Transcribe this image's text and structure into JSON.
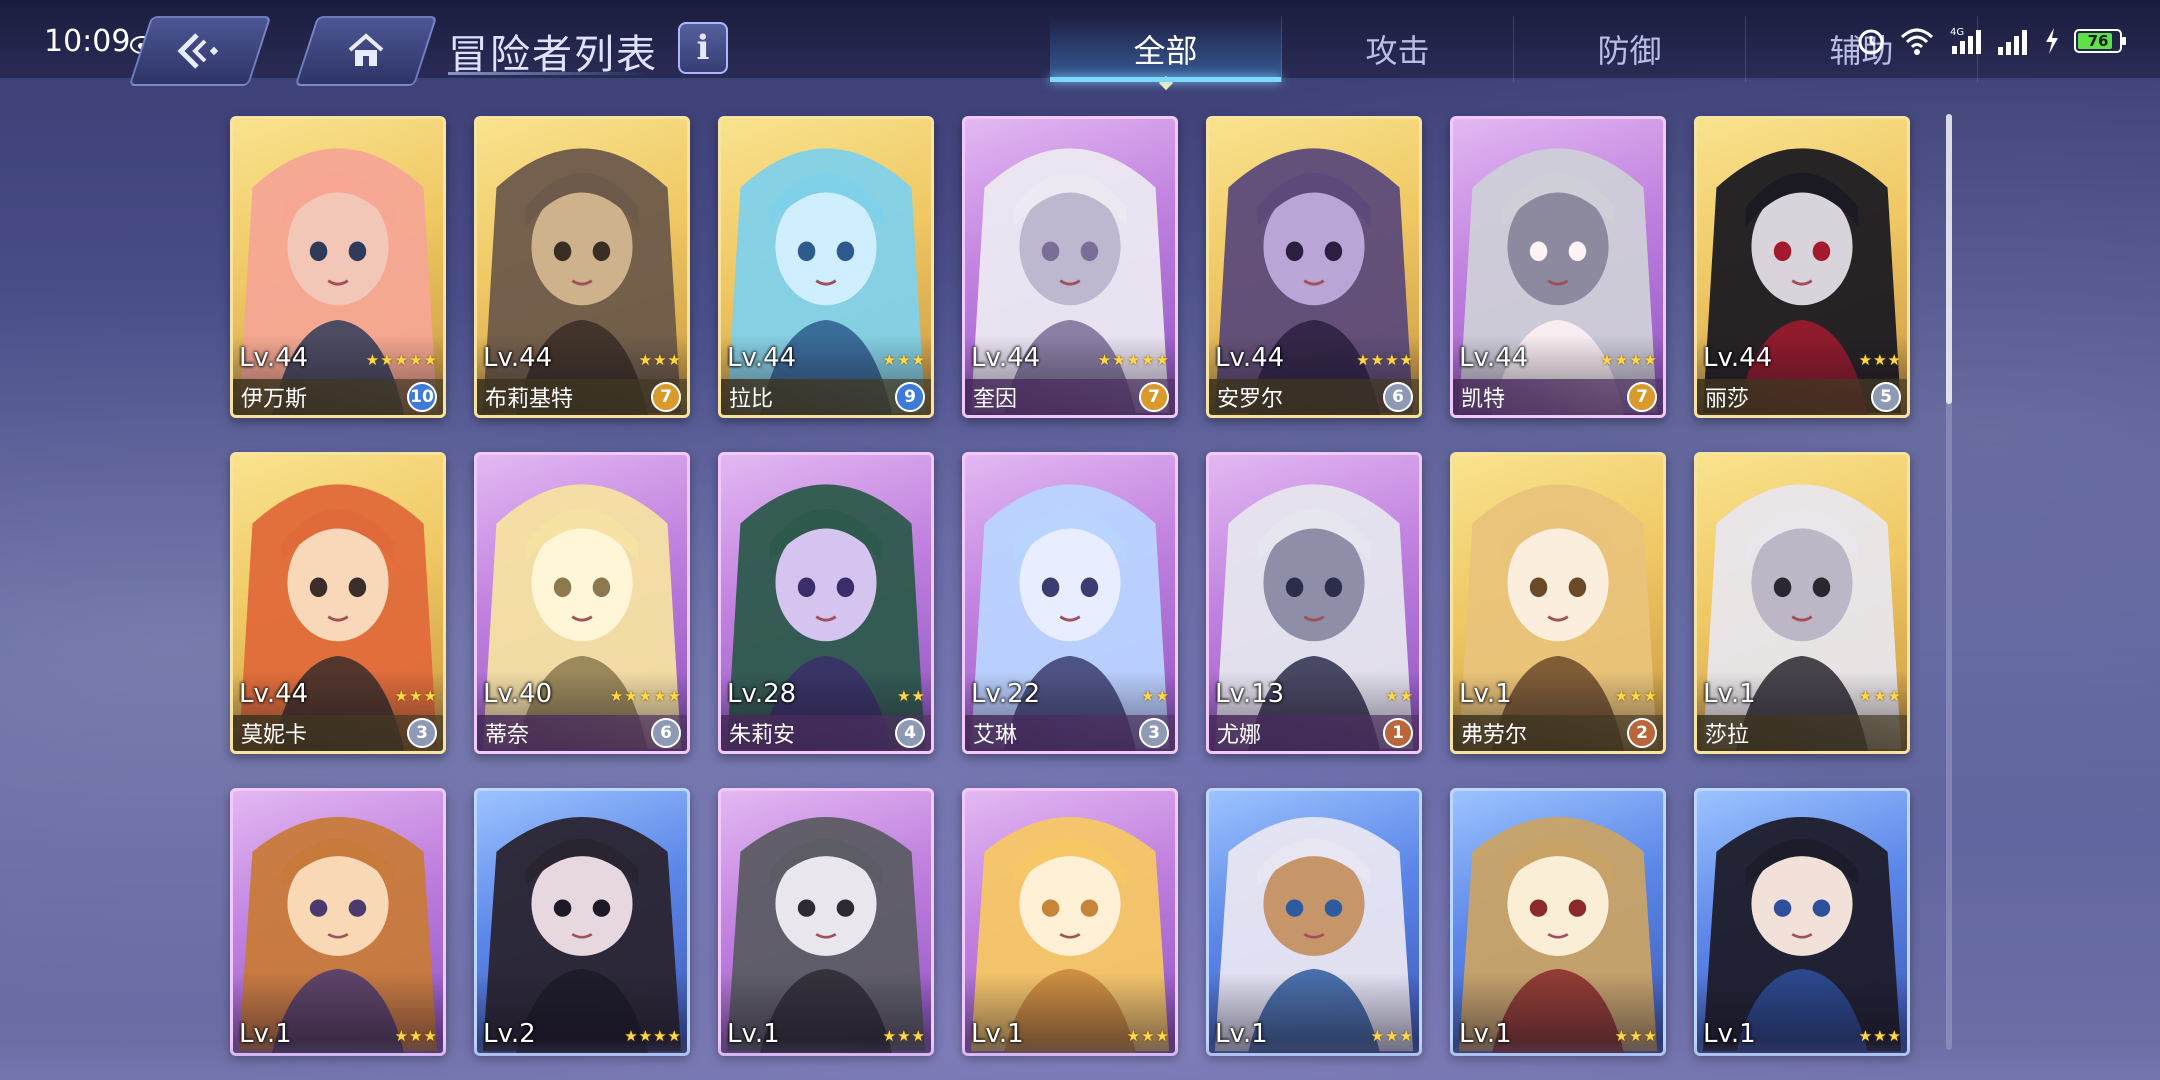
{
  "status_bar": {
    "time": "10:09",
    "battery": "76",
    "network": "4G"
  },
  "header": {
    "title": "冒险者列表",
    "info_label": "i",
    "tabs": [
      {
        "label": "全部",
        "active": true
      },
      {
        "label": "攻击",
        "active": false
      },
      {
        "label": "防御",
        "active": false
      },
      {
        "label": "辅助",
        "active": false
      }
    ]
  },
  "colors": {
    "accent": "#7fd6ff",
    "gold_frame": "#f0c864",
    "purple_frame": "#bf7fde",
    "blue_frame": "#5b86e8"
  },
  "adventurers": [
    {
      "name": "伊万斯",
      "level": "Lv.44",
      "stars": 5,
      "rank": "10",
      "frame": "gold",
      "badge": "blue"
    },
    {
      "name": "布莉基特",
      "level": "Lv.44",
      "stars": 3,
      "rank": "7",
      "frame": "gold",
      "badge": "gold"
    },
    {
      "name": "拉比",
      "level": "Lv.44",
      "stars": 3,
      "rank": "9",
      "frame": "gold",
      "badge": "blue"
    },
    {
      "name": "奎因",
      "level": "Lv.44",
      "stars": 5,
      "rank": "7",
      "frame": "purple",
      "badge": "gold"
    },
    {
      "name": "安罗尔",
      "level": "Lv.44",
      "stars": 4,
      "rank": "6",
      "frame": "gold",
      "badge": "silver"
    },
    {
      "name": "凯特",
      "level": "Lv.44",
      "stars": 4,
      "rank": "7",
      "frame": "purple",
      "badge": "gold"
    },
    {
      "name": "丽莎",
      "level": "Lv.44",
      "stars": 3,
      "rank": "5",
      "frame": "gold",
      "badge": "silver"
    },
    {
      "name": "莫妮卡",
      "level": "Lv.44",
      "stars": 3,
      "rank": "3",
      "frame": "gold",
      "badge": "silver"
    },
    {
      "name": "蒂奈",
      "level": "Lv.40",
      "stars": 5,
      "rank": "6",
      "frame": "purple",
      "badge": "silver"
    },
    {
      "name": "朱莉安",
      "level": "Lv.28",
      "stars": 2,
      "rank": "4",
      "frame": "purple",
      "badge": "silver"
    },
    {
      "name": "艾琳",
      "level": "Lv.22",
      "stars": 2,
      "rank": "3",
      "frame": "purple",
      "badge": "silver"
    },
    {
      "name": "尤娜",
      "level": "Lv.13",
      "stars": 2,
      "rank": "1",
      "frame": "purple",
      "badge": "bronze"
    },
    {
      "name": "弗劳尔",
      "level": "Lv.1",
      "stars": 3,
      "rank": "2",
      "frame": "gold",
      "badge": "bronze"
    },
    {
      "name": "莎拉",
      "level": "Lv.1",
      "stars": 3,
      "rank": "",
      "frame": "gold",
      "badge": ""
    },
    {
      "name": "",
      "level": "Lv.1",
      "stars": 3,
      "rank": "",
      "frame": "purple",
      "badge": ""
    },
    {
      "name": "",
      "level": "Lv.2",
      "stars": 4,
      "rank": "",
      "frame": "blue",
      "badge": ""
    },
    {
      "name": "",
      "level": "Lv.1",
      "stars": 3,
      "rank": "",
      "frame": "purple",
      "badge": ""
    },
    {
      "name": "",
      "level": "Lv.1",
      "stars": 3,
      "rank": "",
      "frame": "purple",
      "badge": ""
    },
    {
      "name": "",
      "level": "Lv.1",
      "stars": 3,
      "rank": "",
      "frame": "blue",
      "badge": ""
    },
    {
      "name": "",
      "level": "Lv.1",
      "stars": 3,
      "rank": "",
      "frame": "blue",
      "badge": ""
    },
    {
      "name": "",
      "level": "Lv.1",
      "stars": 3,
      "rank": "",
      "frame": "blue",
      "badge": ""
    }
  ],
  "scroll": {
    "position_fraction": 0.0,
    "visible_fraction": 0.31
  }
}
